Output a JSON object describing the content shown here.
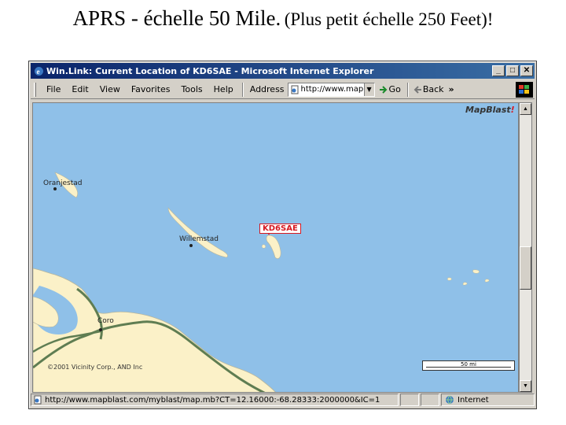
{
  "slide": {
    "title_main": "APRS - échelle 50 Mile.",
    "title_sub": "(Plus petit échelle 250 Feet)!"
  },
  "browser": {
    "window_title": "Win.Link: Current Location of KD6SAE - Microsoft Internet Explorer",
    "controls": {
      "minimize": "_",
      "maximize": "□",
      "close": "✕"
    },
    "menu": [
      "File",
      "Edit",
      "View",
      "Favorites",
      "Tools",
      "Help"
    ],
    "address_label": "Address",
    "address_value": "http://www.mapb",
    "go_label": "Go",
    "back_label": "Back",
    "more_chevron": "»",
    "status_url": "http://www.mapblast.com/myblast/map.mb?CT=12.16000:-68.28333:2000000&IC=1",
    "status_zone": "Internet"
  },
  "map": {
    "logo": "MapBlast",
    "logo_bang": "!",
    "station_label": "KD6SAE",
    "cities": [
      "Oranjestad",
      "Willemstad",
      "Coro"
    ],
    "copyright": "©2001 Vicinity Corp., AND Inc",
    "scale_label": "50 mi"
  },
  "colors": {
    "sea": "#8fc0e8",
    "land": "#fbf1c8",
    "road": "#5f7d52",
    "station": "#d71920",
    "titlebar": "#0a246a"
  },
  "icons": [
    "ie-icon",
    "page-icon",
    "go-arrow-icon",
    "back-arrow-icon",
    "windows-logo-icon",
    "globe-icon"
  ]
}
